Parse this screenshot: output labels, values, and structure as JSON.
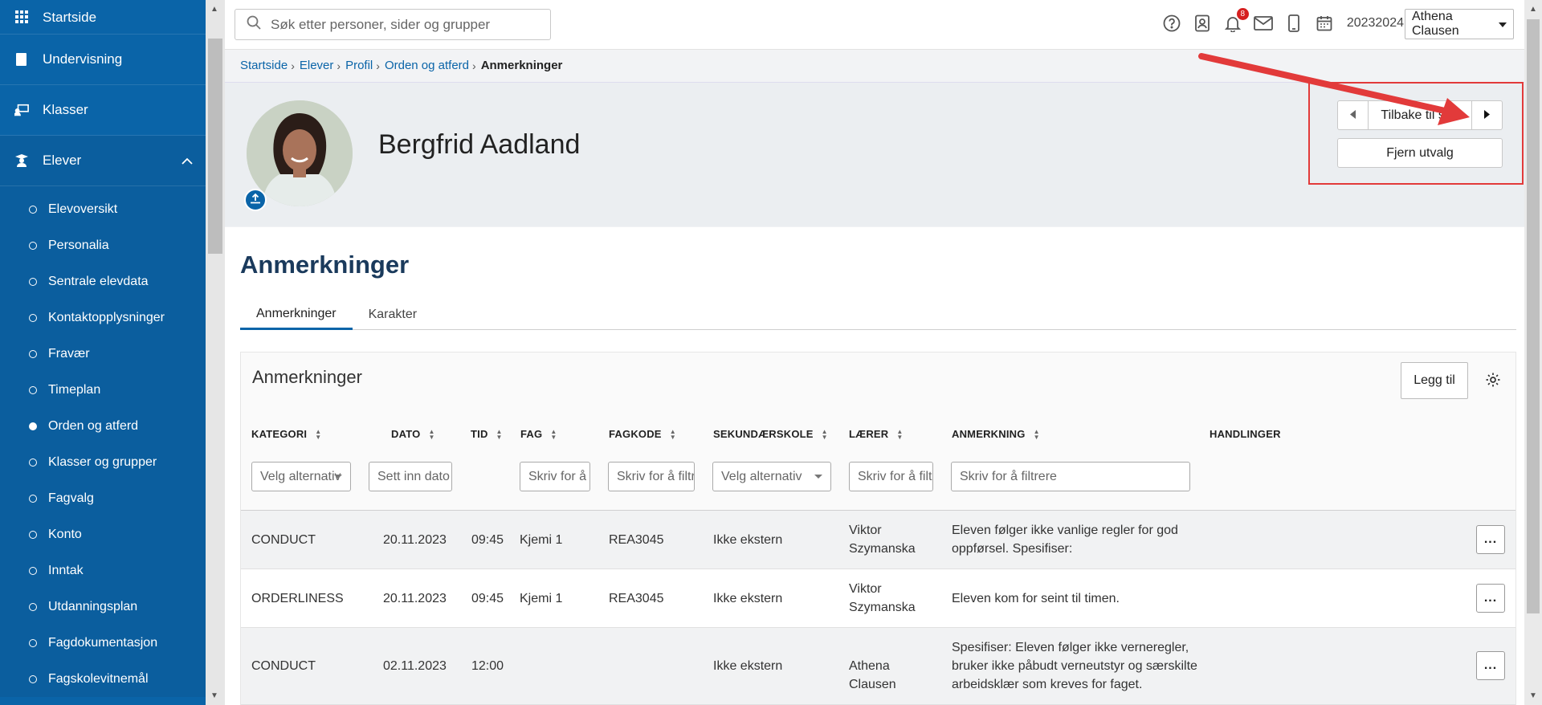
{
  "sidebar": {
    "top_items": [
      {
        "label": "Startside",
        "icon": "grid-icon"
      },
      {
        "label": "Undervisning",
        "icon": "book-icon"
      },
      {
        "label": "Klasser",
        "icon": "classroom-icon"
      },
      {
        "label": "Elever",
        "icon": "student-icon"
      }
    ],
    "sub_items": [
      {
        "label": "Elevoversikt"
      },
      {
        "label": "Personalia"
      },
      {
        "label": "Sentrale elevdata"
      },
      {
        "label": "Kontaktopplysninger"
      },
      {
        "label": "Fravær"
      },
      {
        "label": "Timeplan"
      },
      {
        "label": "Orden og atferd"
      },
      {
        "label": "Klasser og grupper"
      },
      {
        "label": "Fagvalg"
      },
      {
        "label": "Konto"
      },
      {
        "label": "Inntak"
      },
      {
        "label": "Utdanningsplan"
      },
      {
        "label": "Fagdokumentasjon"
      },
      {
        "label": "Fagskolevitnemål"
      }
    ]
  },
  "header": {
    "search_placeholder": "Søk etter personer, sider og grupper",
    "notification_count": "8",
    "school_year": "20232024",
    "user_name": "Athena Clausen"
  },
  "breadcrumb": {
    "items": [
      "Startside",
      "Elever",
      "Profil",
      "Orden og atferd"
    ],
    "current": "Anmerkninger"
  },
  "profile": {
    "name": "Bergfrid Aadland",
    "back_label": "Tilbake til søk",
    "remove_label": "Fjern utvalg"
  },
  "page": {
    "title": "Anmerkninger",
    "tabs": [
      "Anmerkninger",
      "Karakter"
    ]
  },
  "card": {
    "title": "Anmerkninger",
    "add_label": "Legg til"
  },
  "table": {
    "headers": {
      "kategori": "KATEGORI",
      "dato": "DATO",
      "tid": "TID",
      "fag": "FAG",
      "fagkode": "FAGKODE",
      "sekundaer": "SEKUNDÆRSKOLE",
      "laerer": "LÆRER",
      "anmerkning": "ANMERKNING",
      "handlinger": "HANDLINGER"
    },
    "filters": {
      "kategori": "Velg alternativ",
      "dato": "Sett inn dato",
      "fag": "Skriv for å filtrere",
      "fagkode": "Skriv for å filtrere",
      "sekundaer": "Velg alternativ",
      "laerer": "Skriv for å filtrere",
      "anmerkning": "Skriv for å filtrere"
    },
    "rows": [
      {
        "kategori": "CONDUCT",
        "dato": "20.11.2023",
        "tid": "09:45",
        "fag": "Kjemi 1",
        "fagkode": "REA3045",
        "sekundaer": "Ikke ekstern",
        "laerer": "Viktor Szymanska",
        "anmerkning": "Eleven følger ikke vanlige regler for god oppførsel. Spesifiser:",
        "more": "..."
      },
      {
        "kategori": "ORDERLINESS",
        "dato": "20.11.2023",
        "tid": "09:45",
        "fag": "Kjemi 1",
        "fagkode": "REA3045",
        "sekundaer": "Ikke ekstern",
        "laerer": "Viktor Szymanska",
        "anmerkning": "Eleven kom for seint til timen.",
        "more": "..."
      },
      {
        "kategori": "CONDUCT",
        "dato": "02.11.2023",
        "tid": "12:00",
        "fag": "",
        "fagkode": "",
        "sekundaer": "Ikke ekstern",
        "laerer": "Athena Clausen",
        "anmerkning": "Spesifiser: Eleven følger ikke verneregler, bruker ikke påbudt verneutstyr og særskilte arbeidsklær som kreves for faget.",
        "more": "..."
      }
    ]
  },
  "colors": {
    "sidebar_bg": "#0a64a8",
    "accent": "#0a64a8",
    "highlight_red": "#e23a3a",
    "badge_red": "#d62020"
  }
}
